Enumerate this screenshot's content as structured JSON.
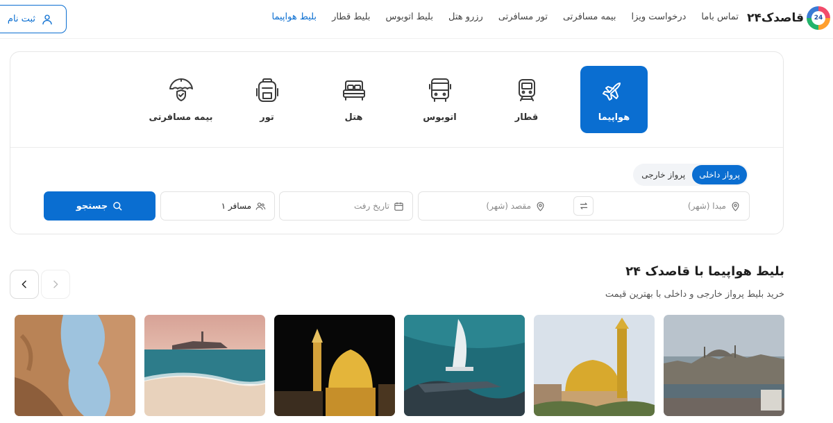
{
  "brand": {
    "logo_text": "قاصدک۲۴",
    "logo_badge": "24"
  },
  "nav": {
    "items": [
      {
        "label": "بلیط هواپیما",
        "active": true
      },
      {
        "label": "بلیط قطار"
      },
      {
        "label": "بلیط اتوبوس"
      },
      {
        "label": "رزرو هتل"
      },
      {
        "label": "تور مسافرتی"
      },
      {
        "label": "بیمه مسافرتی"
      },
      {
        "label": "درخواست ویزا"
      },
      {
        "label": "تماس باما"
      }
    ]
  },
  "auth": {
    "signup_label": "ثبت نام",
    "icon": "user-icon"
  },
  "categories": [
    {
      "label": "هواپیما",
      "icon": "airplane-icon",
      "active": true
    },
    {
      "label": "قطار",
      "icon": "train-icon"
    },
    {
      "label": "اتوبوس",
      "icon": "bus-icon"
    },
    {
      "label": "هتل",
      "icon": "bed-icon"
    },
    {
      "label": "تور",
      "icon": "backpack-icon"
    },
    {
      "label": "بیمه مسافرتی",
      "icon": "umbrella-icon"
    }
  ],
  "trip_type": {
    "domestic": "پرواز داخلی",
    "international": "پرواز خارجی",
    "selected": "domestic"
  },
  "search": {
    "origin_placeholder": "مبدا (شهر)",
    "destination_placeholder": "مقصد (شهر)",
    "date_placeholder": "تاریخ رفت",
    "passengers_value": "۱ مسافر",
    "submit_label": "جستجو"
  },
  "section": {
    "title": "بلیط هواپیما با قاصدک ۲۴",
    "subtitle": "خرید بلیط پرواز خارجی و داخلی با بهترین قیمت"
  },
  "colors": {
    "primary": "#0a6ed1",
    "text": "#2b2b2b",
    "border": "#e6e6e6"
  }
}
